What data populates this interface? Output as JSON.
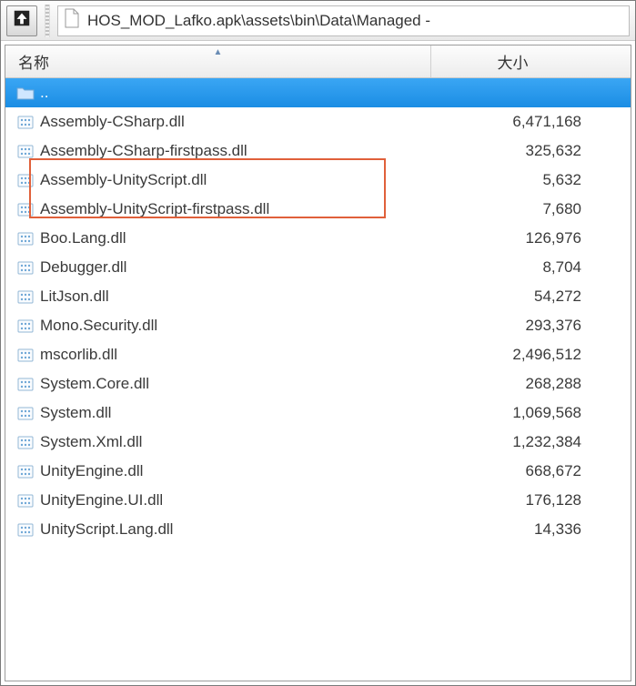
{
  "toolbar": {
    "up_tooltip": "Up",
    "path": "HOS_MOD_Lafko.apk\\assets\\bin\\Data\\Managed -"
  },
  "columns": {
    "name": "名称",
    "size": "大小"
  },
  "parent_row": {
    "label": ".."
  },
  "files": [
    {
      "name": "Assembly-CSharp.dll",
      "size": "6,471,168"
    },
    {
      "name": "Assembly-CSharp-firstpass.dll",
      "size": "325,632"
    },
    {
      "name": "Assembly-UnityScript.dll",
      "size": "5,632"
    },
    {
      "name": "Assembly-UnityScript-firstpass.dll",
      "size": "7,680"
    },
    {
      "name": "Boo.Lang.dll",
      "size": "126,976"
    },
    {
      "name": "Debugger.dll",
      "size": "8,704"
    },
    {
      "name": "LitJson.dll",
      "size": "54,272"
    },
    {
      "name": "Mono.Security.dll",
      "size": "293,376"
    },
    {
      "name": "mscorlib.dll",
      "size": "2,496,512"
    },
    {
      "name": "System.Core.dll",
      "size": "268,288"
    },
    {
      "name": "System.dll",
      "size": "1,069,568"
    },
    {
      "name": "System.Xml.dll",
      "size": "1,232,384"
    },
    {
      "name": "UnityEngine.dll",
      "size": "668,672"
    },
    {
      "name": "UnityEngine.UI.dll",
      "size": "176,128"
    },
    {
      "name": "UnityScript.Lang.dll",
      "size": "14,336"
    }
  ]
}
